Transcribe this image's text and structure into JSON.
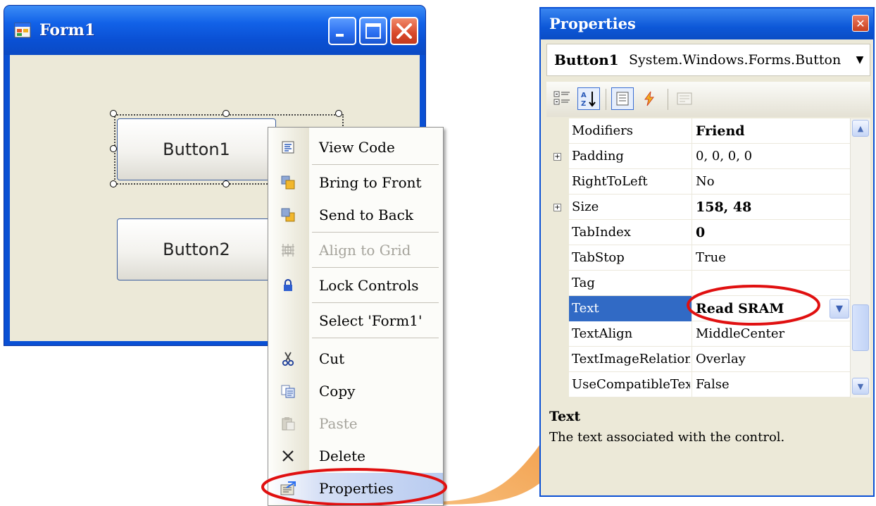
{
  "form": {
    "title": "Form1",
    "button1_label": "Button1",
    "button2_label": "Button2"
  },
  "context_menu": {
    "items": [
      {
        "label": "View Code",
        "icon": "view-code-icon",
        "enabled": true
      },
      {
        "label": "Bring to Front",
        "icon": "bring-to-front-icon",
        "enabled": true
      },
      {
        "label": "Send to Back",
        "icon": "send-to-back-icon",
        "enabled": true
      },
      {
        "label": "Align to Grid",
        "icon": "align-to-grid-icon",
        "enabled": false
      },
      {
        "label": "Lock Controls",
        "icon": "lock-icon",
        "enabled": true
      },
      {
        "label": "Select 'Form1'",
        "icon": "",
        "enabled": true
      },
      {
        "label": "Cut",
        "icon": "scissors-icon",
        "enabled": true
      },
      {
        "label": "Copy",
        "icon": "copy-icon",
        "enabled": true
      },
      {
        "label": "Paste",
        "icon": "paste-icon",
        "enabled": false
      },
      {
        "label": "Delete",
        "icon": "delete-x-icon",
        "enabled": true
      },
      {
        "label": "Properties",
        "icon": "properties-icon",
        "enabled": true
      }
    ]
  },
  "properties": {
    "title": "Properties",
    "object_name": "Button1",
    "object_type": "System.Windows.Forms.Button",
    "rows": [
      {
        "name": "Modifiers",
        "value": "Friend",
        "bold": true,
        "expandable": false,
        "selected": false
      },
      {
        "name": "Padding",
        "value": "0, 0, 0, 0",
        "bold": false,
        "expandable": true,
        "selected": false
      },
      {
        "name": "RightToLeft",
        "value": "No",
        "bold": false,
        "expandable": false,
        "selected": false
      },
      {
        "name": "Size",
        "value": "158, 48",
        "bold": true,
        "expandable": true,
        "selected": false
      },
      {
        "name": "TabIndex",
        "value": "0",
        "bold": true,
        "expandable": false,
        "selected": false
      },
      {
        "name": "TabStop",
        "value": "True",
        "bold": false,
        "expandable": false,
        "selected": false
      },
      {
        "name": "Tag",
        "value": "",
        "bold": false,
        "expandable": false,
        "selected": false
      },
      {
        "name": "Text",
        "value": "Read SRAM",
        "bold": true,
        "expandable": false,
        "selected": true
      },
      {
        "name": "TextAlign",
        "value": "MiddleCenter",
        "bold": false,
        "expandable": false,
        "selected": false
      },
      {
        "name": "TextImageRelation",
        "value": "Overlay",
        "bold": false,
        "expandable": false,
        "selected": false
      },
      {
        "name": "UseCompatibleTex",
        "value": "False",
        "bold": false,
        "expandable": false,
        "selected": false
      }
    ],
    "description_title": "Text",
    "description_body": "The text associated with the control."
  },
  "colors": {
    "xp_blue": "#0a50d4",
    "selection": "#316ac5",
    "highlight_red": "#e01010",
    "arrow_orange": "#f29a3c"
  }
}
